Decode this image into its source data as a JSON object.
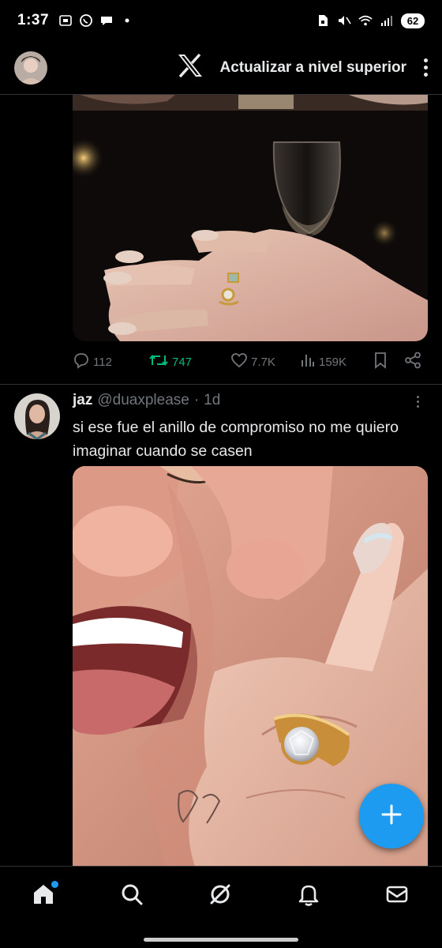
{
  "status_bar": {
    "time": "1:37",
    "battery": "62"
  },
  "app_bar": {
    "upgrade_label": "Actualizar a nivel superior",
    "logo": "x-logo-icon"
  },
  "tweet1": {
    "replies": "112",
    "retweets": "747",
    "likes": "7.7K",
    "views": "159K",
    "retweeted": true
  },
  "tweet2": {
    "name": "jaz",
    "handle": "@duaxplease",
    "separator": "·",
    "age": "1d",
    "text": "si ese fue el anillo de compromiso no me quiero imaginar cuando se casen"
  },
  "colors": {
    "accent": "#1d9bf0",
    "retweet_green": "#00ba7c",
    "muted": "#71767b",
    "text": "#e7e9ea",
    "border": "#2f3336"
  },
  "nav": {
    "items": [
      "home-icon",
      "search-icon",
      "grok-icon",
      "notifications-icon",
      "messages-icon"
    ],
    "active": "home-icon"
  }
}
